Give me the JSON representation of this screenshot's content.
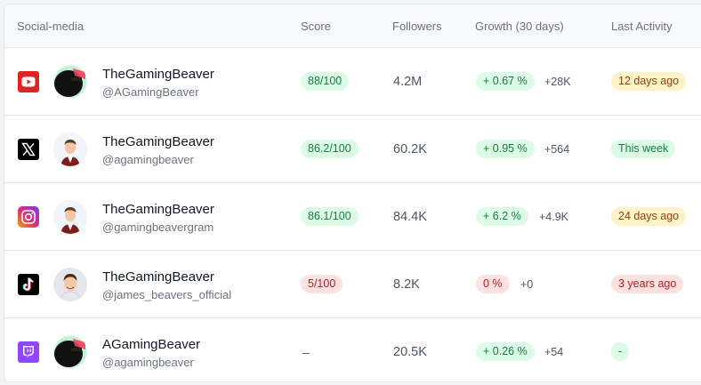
{
  "columns": {
    "social": "Social-media",
    "score": "Score",
    "followers": "Followers",
    "growth": "Growth (30 days)",
    "activity": "Last Activity"
  },
  "rows": [
    {
      "platform": "youtube-icon",
      "name": "TheGamingBeaver",
      "handle": "@AGamingBeaver",
      "score": "88/100",
      "followers": "4.2M",
      "growth": "+ 0.67 %",
      "delta": "+28K",
      "activity": "12 days ago"
    },
    {
      "platform": "x-icon",
      "name": "TheGamingBeaver",
      "handle": "@agamingbeaver",
      "score": "86.2/100",
      "followers": "60.2K",
      "growth": "+ 0.95 %",
      "delta": "+564",
      "activity": "This week"
    },
    {
      "platform": "instagram-icon",
      "name": "TheGamingBeaver",
      "handle": "@gamingbeavergram",
      "score": "86.1/100",
      "followers": "84.4K",
      "growth": "+ 6.2 %",
      "delta": "+4.9K",
      "activity": "24 days ago"
    },
    {
      "platform": "tiktok-icon",
      "name": "TheGamingBeaver",
      "handle": "@james_beavers_official",
      "score": "5/100",
      "followers": "8.2K",
      "growth": "0 %",
      "delta": "+0",
      "activity": "3 years ago"
    },
    {
      "platform": "twitch-icon",
      "name": "AGamingBeaver",
      "handle": "@agamingbeaver",
      "score": "–",
      "followers": "20.5K",
      "growth": "+ 0.26 %",
      "delta": "+54",
      "activity": "-"
    }
  ],
  "colors": {
    "green_bg": "#dcfce7",
    "red_bg": "#fee2e2",
    "amber_bg": "#fef3c7"
  }
}
